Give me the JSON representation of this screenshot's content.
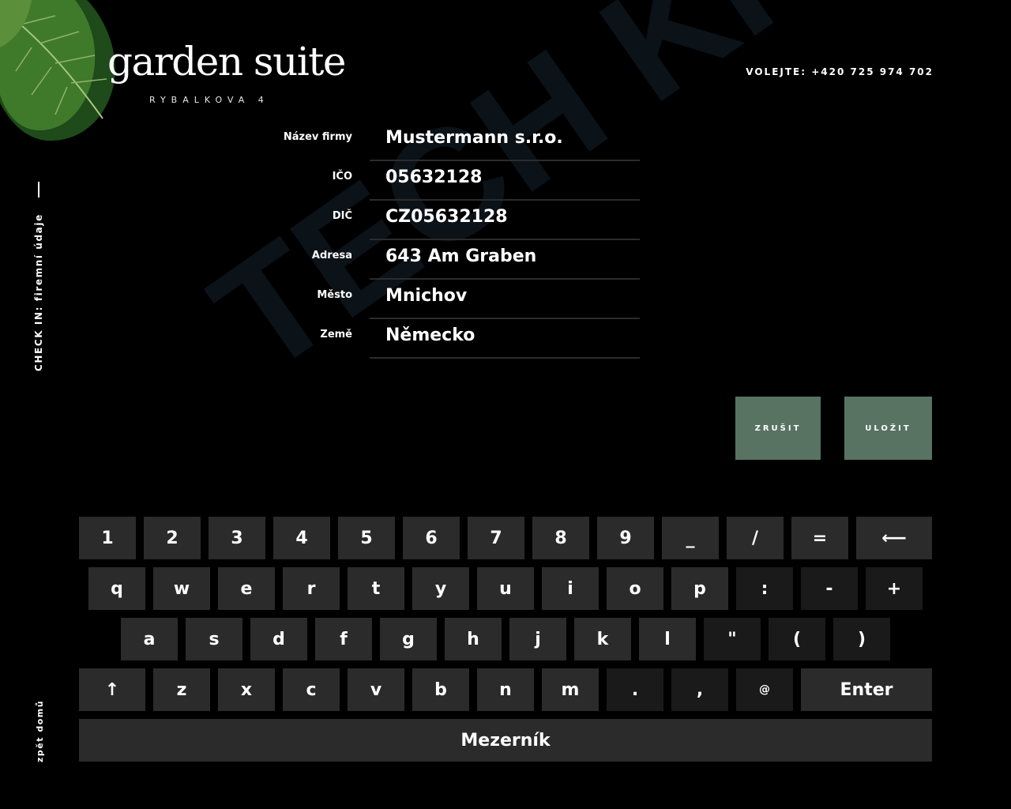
{
  "brand": {
    "title": "garden suite",
    "subtitle": "RYBALKOVA 4",
    "phone": "VOLEJTE: +420 725 974 702"
  },
  "sidebar": {
    "section_label": "CHECK IN: firemní údaje",
    "back_label": "zpět domů"
  },
  "watermark": "TECH KIOSK",
  "form": {
    "fields": [
      {
        "label": "Název firmy",
        "value": "Mustermann s.r.o."
      },
      {
        "label": "IČO",
        "value": "05632128"
      },
      {
        "label": "DIČ",
        "value": "CZ05632128"
      },
      {
        "label": "Adresa",
        "value": "643 Am Graben"
      },
      {
        "label": "Město",
        "value": "Mnichov"
      },
      {
        "label": "Země",
        "value": "Německo"
      }
    ]
  },
  "actions": {
    "cancel_label": "ZRUŠIT",
    "save_label": "ULOŽIT"
  },
  "colors": {
    "background": "#000000",
    "button_green": "#587362",
    "key_bg": "#2b2b2b",
    "key_dark_bg": "#1a1a1a"
  },
  "keyboard": {
    "rows": [
      [
        "1",
        "2",
        "3",
        "4",
        "5",
        "6",
        "7",
        "8",
        "9",
        "_",
        "/",
        "=",
        "⟵"
      ],
      [
        "q",
        "w",
        "e",
        "r",
        "t",
        "y",
        "u",
        "i",
        "o",
        "p",
        ":",
        "-",
        "+"
      ],
      [
        "a",
        "s",
        "d",
        "f",
        "g",
        "h",
        "j",
        "k",
        "l",
        "\"",
        "(",
        ")"
      ],
      [
        "↑",
        "z",
        "x",
        "c",
        "v",
        "b",
        "n",
        "m",
        ".",
        ",",
        "@",
        "Enter"
      ],
      [
        "Mezerník"
      ]
    ]
  }
}
